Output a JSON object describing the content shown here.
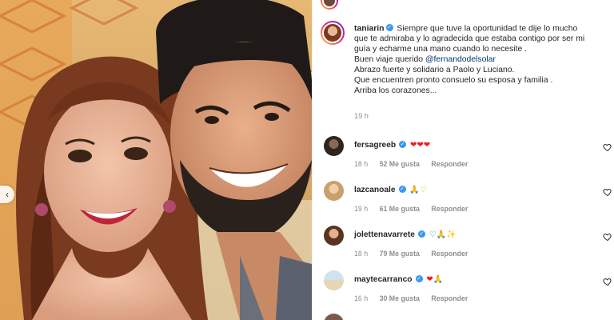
{
  "post": {
    "author": "taniarin",
    "caption_lines": [
      "Siempre que tuve la oportunidad te dije lo mucho",
      "que te admiraba y lo agradecida que estaba contigo por ser mi",
      "guía y echarme una mano cuando lo necesite .",
      "Buen viaje querido",
      "Abrazo fuerte y solidario a Paolo y Luciano.",
      "Que encuentren pronto consuelo su esposa y familia .",
      "Arriba los corazones..."
    ],
    "mention": "@fernandodelsolar",
    "time": "19 h"
  },
  "comments": [
    {
      "user": "fersagreeb",
      "emoji": "❤❤❤",
      "time": "18 h",
      "likes": "52 Me gusta",
      "reply": "Responder"
    },
    {
      "user": "lazcanoale",
      "emoji": "🙏♡",
      "time": "19 h",
      "likes": "61 Me gusta",
      "reply": "Responder"
    },
    {
      "user": "jolettenavarrete",
      "emoji": "♡🙏✨",
      "time": "18 h",
      "likes": "79 Me gusta",
      "reply": "Responder"
    },
    {
      "user": "maytecarranco",
      "emoji": "❤🙏",
      "time": "16 h",
      "likes": "30 Me gusta",
      "reply": "Responder"
    }
  ],
  "icons": {
    "carousel_prev": "chevron-left-icon",
    "verified": "verified-badge-icon",
    "like": "heart-outline-icon"
  },
  "colors": {
    "verified": "#3897f0",
    "mention": "#00376b",
    "meta": "#8e8e8e",
    "text": "#262626"
  }
}
